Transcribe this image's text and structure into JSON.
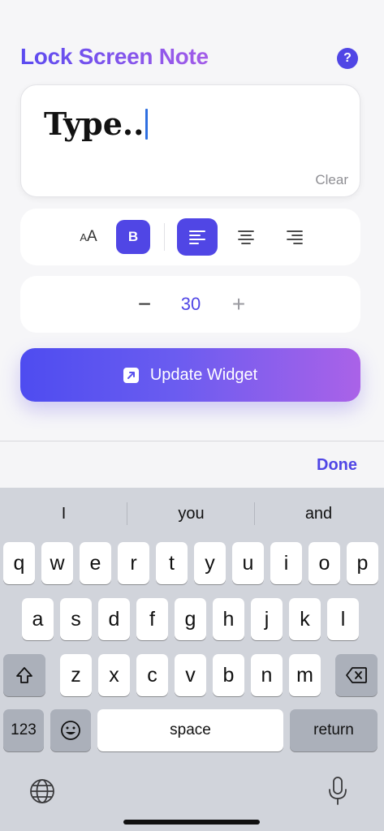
{
  "header": {
    "title": "Lock Screen Note",
    "help_label": "?"
  },
  "note": {
    "text": "Type..",
    "clear_label": "Clear"
  },
  "format": {
    "size_small": "A",
    "size_big": "A",
    "bold_label": "B",
    "alignment": "left"
  },
  "font_size": {
    "minus": "−",
    "value": "30",
    "plus": "+"
  },
  "update": {
    "label": "Update Widget"
  },
  "accessory": {
    "done_label": "Done"
  },
  "suggestions": [
    "I",
    "you",
    "and"
  ],
  "keys": {
    "row1": [
      "q",
      "w",
      "e",
      "r",
      "t",
      "y",
      "u",
      "i",
      "o",
      "p"
    ],
    "row2": [
      "a",
      "s",
      "d",
      "f",
      "g",
      "h",
      "j",
      "k",
      "l"
    ],
    "row3": [
      "z",
      "x",
      "c",
      "v",
      "b",
      "n",
      "m"
    ],
    "numbers_label": "123",
    "space_label": "space",
    "return_label": "return"
  },
  "colors": {
    "accent": "#5046e5",
    "gradient_start": "#4e4cf0",
    "gradient_end": "#aa62e8",
    "keyboard_bg": "#d1d4db"
  }
}
